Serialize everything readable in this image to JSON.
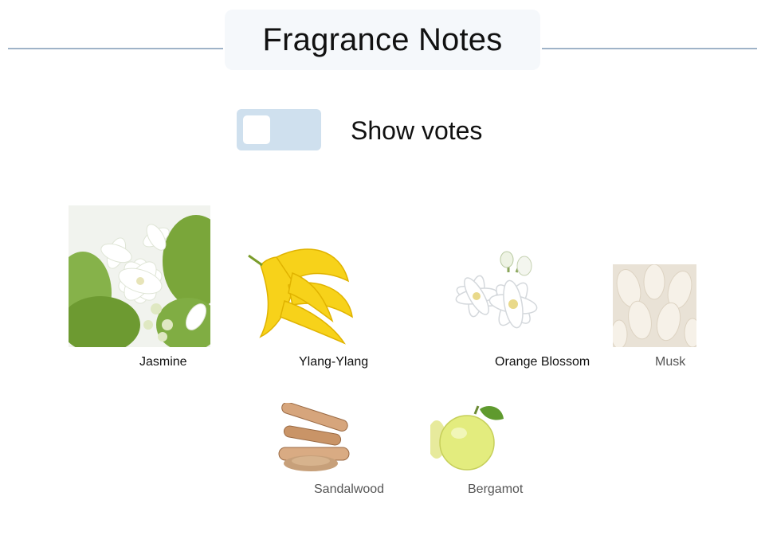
{
  "header": {
    "title": "Fragrance Notes"
  },
  "toggle": {
    "label": "Show votes",
    "checked": false
  },
  "notes": [
    {
      "name": "Jasmine",
      "icon": "jasmine-icon"
    },
    {
      "name": "Ylang-Ylang",
      "icon": "ylang-ylang-icon"
    },
    {
      "name": "Orange Blossom",
      "icon": "orange-blossom-icon"
    },
    {
      "name": "Musk",
      "icon": "musk-icon"
    },
    {
      "name": "Sandalwood",
      "icon": "sandalwood-icon"
    },
    {
      "name": "Bergamot",
      "icon": "bergamot-icon"
    }
  ],
  "colors": {
    "rule": "#9fb3c8",
    "title_bg": "#f5f8fb",
    "toggle_track": "#cfe0ee",
    "primary_text": "#111111",
    "secondary_text": "#555555"
  }
}
